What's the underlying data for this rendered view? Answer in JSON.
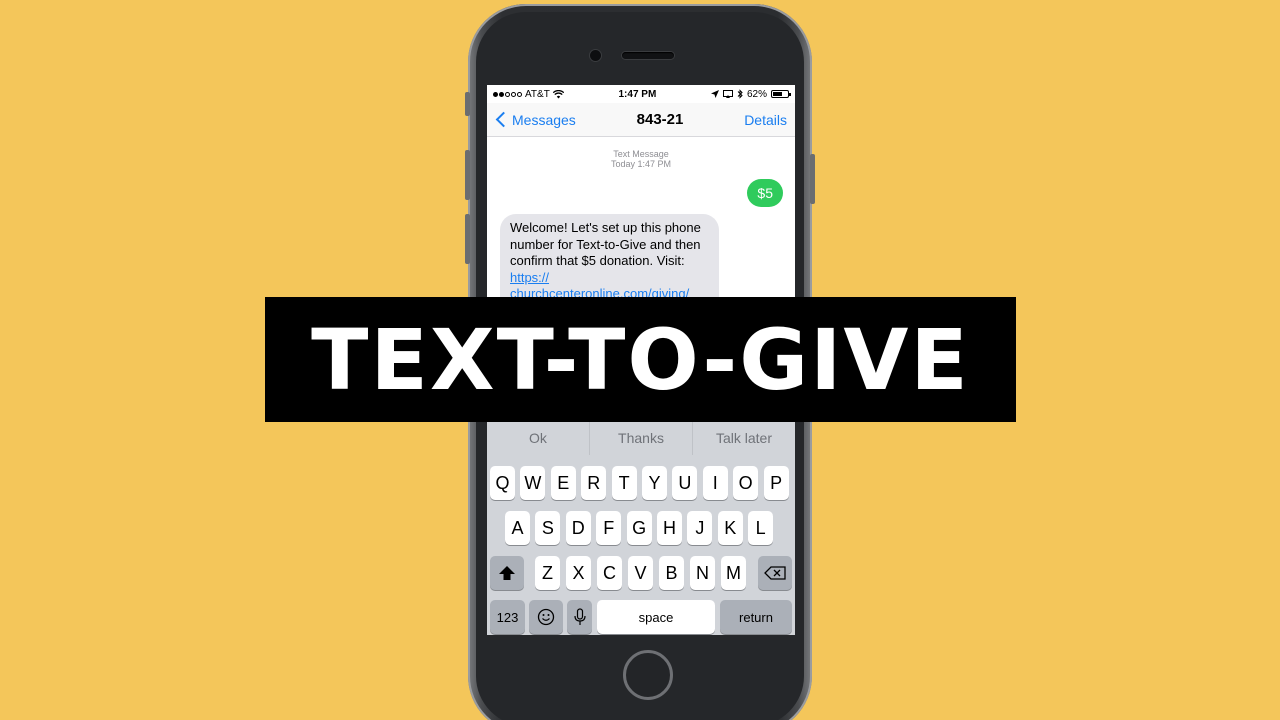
{
  "status": {
    "carrier": "AT&T",
    "time": "1:47 PM",
    "battery": "62%",
    "battery_level": 0.62
  },
  "nav": {
    "back_label": "Messages",
    "title": "843-21",
    "details_label": "Details"
  },
  "conversation": {
    "meta_line1": "Text Message",
    "meta_line2": "Today 1:47 PM",
    "outgoing": "$5",
    "incoming_text": "Welcome! Let's set up this phone number for Text-to-Give and then confirm that $5 donation. Visit: ",
    "incoming_link": "https:// churchcenteronline.com/giving/"
  },
  "suggestions": [
    "Ok",
    "Thanks",
    "Talk later"
  ],
  "keyboard": {
    "row1": [
      "Q",
      "W",
      "E",
      "R",
      "T",
      "Y",
      "U",
      "I",
      "O",
      "P"
    ],
    "row2": [
      "A",
      "S",
      "D",
      "F",
      "G",
      "H",
      "J",
      "K",
      "L"
    ],
    "row3": [
      "Z",
      "X",
      "C",
      "V",
      "B",
      "N",
      "M"
    ],
    "numbers_label": "123",
    "space_label": "space",
    "return_label": "return"
  },
  "banner": {
    "text": "TEXT-TO-GIVE"
  },
  "colors": {
    "background": "#F4C65A",
    "ios_blue": "#1a7ef0",
    "imessage_green": "#2fcb5c"
  }
}
